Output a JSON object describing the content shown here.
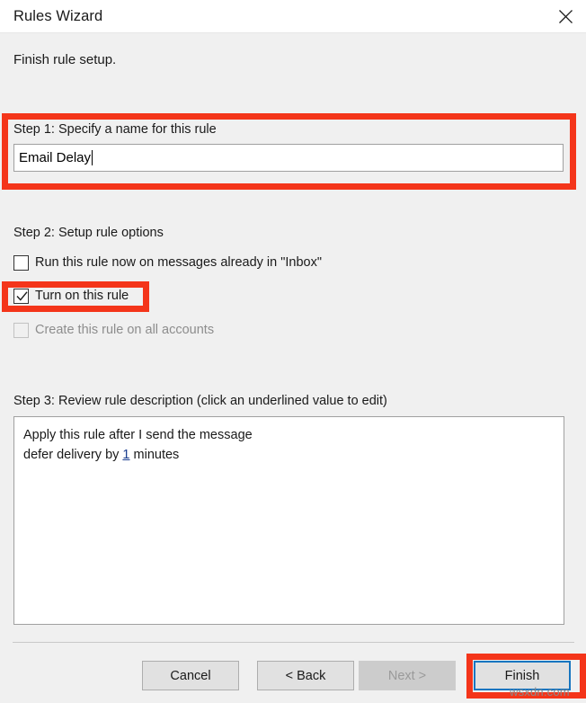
{
  "window": {
    "title": "Rules Wizard",
    "close_icon": "close-icon",
    "subtitle": "Finish rule setup."
  },
  "step1": {
    "label": "Step 1: Specify a name for this rule",
    "name_value": "Email Delay",
    "name_placeholder": ""
  },
  "step2": {
    "label": "Step 2: Setup rule options",
    "options": [
      {
        "label": "Run this rule now on messages already in \"Inbox\"",
        "checked": false,
        "disabled": false
      },
      {
        "label": "Turn on this rule",
        "checked": true,
        "disabled": false
      },
      {
        "label": "Create this rule on all accounts",
        "checked": false,
        "disabled": true
      }
    ]
  },
  "step3": {
    "label": "Step 3: Review rule description (click an underlined value to edit)",
    "description_line1": "Apply this rule after I send the message",
    "description_line2_prefix": "defer delivery by ",
    "description_line2_link": "1",
    "description_line2_suffix": " minutes"
  },
  "buttons": {
    "cancel": "Cancel",
    "back": "< Back",
    "next": "Next >",
    "finish": "Finish"
  },
  "annotations": {
    "highlight_color": "#f4351a",
    "focus_color": "#1675c0",
    "targets": [
      "step-1-name-field",
      "turn-on-this-rule-checkbox",
      "finish-button"
    ]
  },
  "watermark": "wsxdn.com"
}
